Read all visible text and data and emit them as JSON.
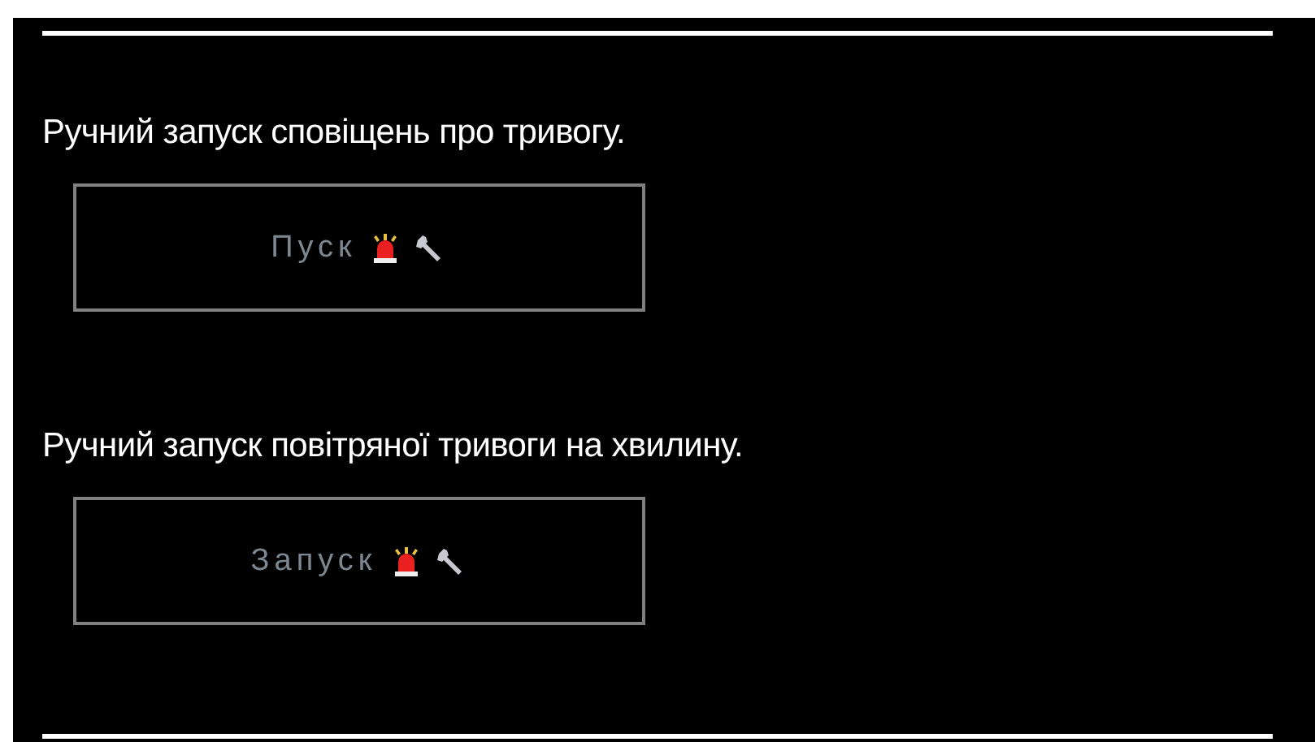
{
  "sections": [
    {
      "description": "Ручний запуск сповіщень про тривогу.",
      "button": {
        "label": "Пуск",
        "disabled": true
      }
    },
    {
      "description": "Ручний запуск повітряної тривоги на хвилину.",
      "button": {
        "label": "Запуск",
        "disabled": true
      }
    }
  ]
}
